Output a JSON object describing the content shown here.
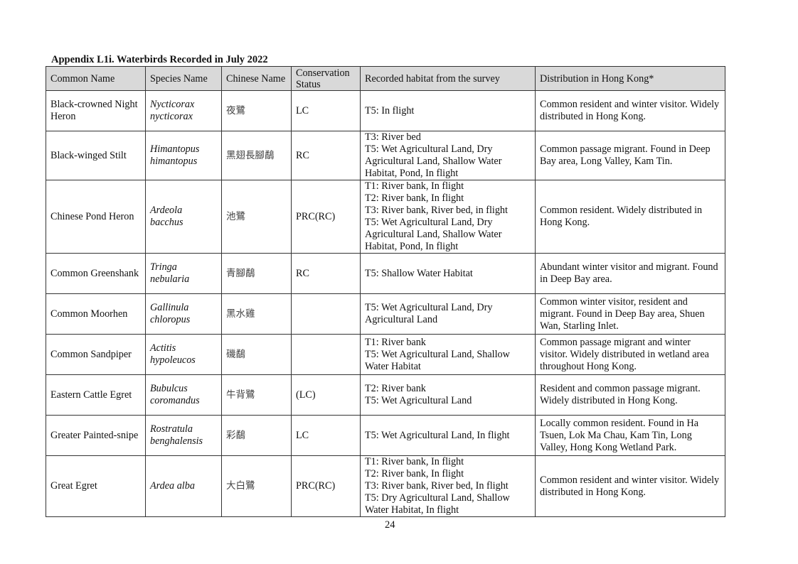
{
  "document": {
    "title": "Appendix L1i. Waterbirds Recorded in July 2022",
    "page_number": "24"
  },
  "table": {
    "headers": [
      "Common Name",
      "Species Name",
      "Chinese Name",
      "Conservation Status",
      "Recorded habitat from the survey",
      "Distribution in Hong Kong*"
    ],
    "rows": [
      {
        "common_name": "Black-crowned Night Heron",
        "species_name": "Nycticorax nycticorax",
        "chinese_name": "夜鷺",
        "status": "LC",
        "habitat": [
          "T5: In flight"
        ],
        "distribution": "Common resident and winter visitor. Widely distributed in Hong Kong."
      },
      {
        "common_name": "Black-winged Stilt",
        "species_name": "Himantopus himantopus",
        "chinese_name": "黑翅長腳鷸",
        "status": "RC",
        "habitat": [
          "T3: River bed",
          "T5: Wet Agricultural Land, Dry Agricultural Land, Shallow Water Habitat, Pond, In flight"
        ],
        "distribution": "Common passage migrant. Found in Deep Bay area, Long Valley, Kam Tin."
      },
      {
        "common_name": "Chinese Pond Heron",
        "species_name": "Ardeola bacchus",
        "chinese_name": "池鷺",
        "status": "PRC(RC)",
        "habitat": [
          "T1: River bank, In flight",
          "T2: River bank, In flight",
          "T3: River bank, River bed, in flight",
          "T5: Wet Agricultural Land, Dry Agricultural Land, Shallow Water Habitat, Pond, In flight"
        ],
        "distribution": "Common resident. Widely distributed in Hong Kong."
      },
      {
        "common_name": "Common Greenshank",
        "species_name": "Tringa nebularia",
        "chinese_name": "青腳鷸",
        "status": "RC",
        "habitat": [
          "T5: Shallow Water Habitat"
        ],
        "distribution": "Abundant winter visitor and migrant. Found in Deep Bay area."
      },
      {
        "common_name": "Common Moorhen",
        "species_name": "Gallinula chloropus",
        "chinese_name": "黑水雞",
        "status": "",
        "habitat": [
          "T5: Wet Agricultural Land, Dry Agricultural Land"
        ],
        "distribution": "Common winter visitor, resident and migrant. Found in Deep Bay area, Shuen Wan, Starling Inlet."
      },
      {
        "common_name": "Common Sandpiper",
        "species_name": "Actitis hypoleucos",
        "chinese_name": "磯鷸",
        "status": "",
        "habitat": [
          "T1: River bank",
          "T5: Wet Agricultural Land, Shallow Water Habitat"
        ],
        "distribution": "Common passage migrant and winter visitor. Widely distributed in wetland area throughout Hong Kong."
      },
      {
        "common_name": "Eastern Cattle Egret",
        "species_name": "Bubulcus coromandus",
        "chinese_name": "牛背鷺",
        "status": "(LC)",
        "habitat": [
          "T2: River bank",
          "T5: Wet Agricultural Land"
        ],
        "distribution": "Resident and common passage migrant. Widely distributed in Hong Kong."
      },
      {
        "common_name": "Greater Painted-snipe",
        "species_name": "Rostratula benghalensis",
        "chinese_name": "彩鷸",
        "status": "LC",
        "habitat": [
          "T5: Wet Agricultural Land, In flight"
        ],
        "distribution": "Locally common resident. Found in Ha Tsuen, Lok Ma Chau, Kam Tin, Long Valley, Hong Kong Wetland Park."
      },
      {
        "common_name": "Great Egret",
        "species_name": "Ardea alba",
        "chinese_name": "大白鷺",
        "status": "PRC(RC)",
        "habitat": [
          "T1: River bank, In flight",
          "T2: River bank, In flight",
          "T3: River bank, River bed, In flight",
          "T5: Dry Agricultural Land, Shallow Water Habitat, In flight"
        ],
        "distribution": "Common resident and winter visitor. Widely distributed in Hong Kong."
      }
    ]
  }
}
